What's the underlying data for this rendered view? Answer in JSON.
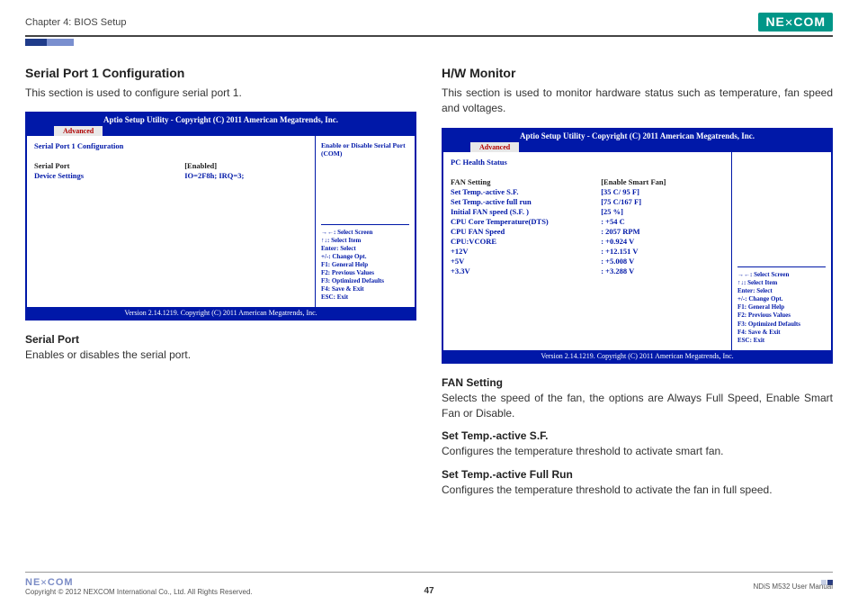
{
  "header": {
    "chapter": "Chapter 4: BIOS Setup",
    "logo_text": "NEXCOM"
  },
  "left": {
    "title": "Serial Port 1 Configuration",
    "desc": "This section is used to configure serial port 1.",
    "bios": {
      "title": "Aptio Setup Utility - Copyright (C) 2011 American Megatrends, Inc.",
      "tab": "Advanced",
      "heading": "Serial Port 1 Configuration",
      "rows": [
        {
          "label": "Serial Port",
          "value": "[Enabled]",
          "style": "white"
        },
        {
          "label": "Device Settings",
          "value": "IO=2F8h; IRQ=3;",
          "style": "bold"
        }
      ],
      "side_hint": "Enable or Disable Serial Port (COM)",
      "help": [
        "→←: Select Screen",
        "↑↓: Select Item",
        "Enter: Select",
        "+/-: Change Opt.",
        "F1: General Help",
        "F2: Previous Values",
        "F3: Optimized Defaults",
        "F4: Save & Exit",
        "ESC: Exit"
      ],
      "footer": "Version 2.14.1219. Copyright (C) 2011 American Megatrends, Inc."
    },
    "sub1_title": "Serial Port",
    "sub1_desc": "Enables or disables the serial port."
  },
  "right": {
    "title": "H/W Monitor",
    "desc": "This section is used to monitor hardware status such as temperature, fan speed and voltages.",
    "bios": {
      "title": "Aptio Setup Utility - Copyright (C) 2011 American Megatrends, Inc.",
      "tab": "Advanced",
      "heading": "PC Health Status",
      "rows": [
        {
          "label": "FAN Setting",
          "value": "[Enable Smart Fan]",
          "style": "white"
        },
        {
          "label": "Set Temp.-active S.F.",
          "value": "[35 C/ 95 F]",
          "style": "blue"
        },
        {
          "label": "Set Temp.-active full run",
          "value": "[75 C/167 F]",
          "style": "blue"
        },
        {
          "label": "Initial FAN speed (S.F. )",
          "value": "[25 %]",
          "style": "blue"
        },
        {
          "label": "CPU Core Temperature(DTS)",
          "value": ": +54 C",
          "style": "bold"
        },
        {
          "label": "CPU FAN Speed",
          "value": ": 2057 RPM",
          "style": "bold"
        },
        {
          "label": "CPU:VCORE",
          "value": ": +0.924 V",
          "style": "bold"
        },
        {
          "label": "+12V",
          "value": ": +12.151 V",
          "style": "bold"
        },
        {
          "label": "+5V",
          "value": ": +5.008 V",
          "style": "bold"
        },
        {
          "label": "+3.3V",
          "value": ": +3.288 V",
          "style": "bold"
        }
      ],
      "side_hint": "",
      "help": [
        "→←: Select Screen",
        "↑↓: Select Item",
        "Enter: Select",
        "+/-: Change Opt.",
        "F1: General Help",
        "F2: Previous Values",
        "F3: Optimized Defaults",
        "F4: Save & Exit",
        "ESC: Exit"
      ],
      "footer": "Version 2.14.1219. Copyright (C) 2011 American Megatrends, Inc."
    },
    "sub1_title": "FAN Setting",
    "sub1_desc": "Selects the speed of the fan, the options are Always Full Speed, Enable Smart Fan or Disable.",
    "sub2_title": "Set Temp.-active S.F.",
    "sub2_desc": "Configures the temperature threshold to activate smart fan.",
    "sub3_title": "Set Temp.-active Full Run",
    "sub3_desc": "Configures the temperature threshold to activate the fan in full speed."
  },
  "footer": {
    "copyright": "Copyright © 2012 NEXCOM International Co., Ltd. All Rights Reserved.",
    "page": "47",
    "manual": "NDiS M532 User Manual",
    "logo": "NEXCOM"
  }
}
